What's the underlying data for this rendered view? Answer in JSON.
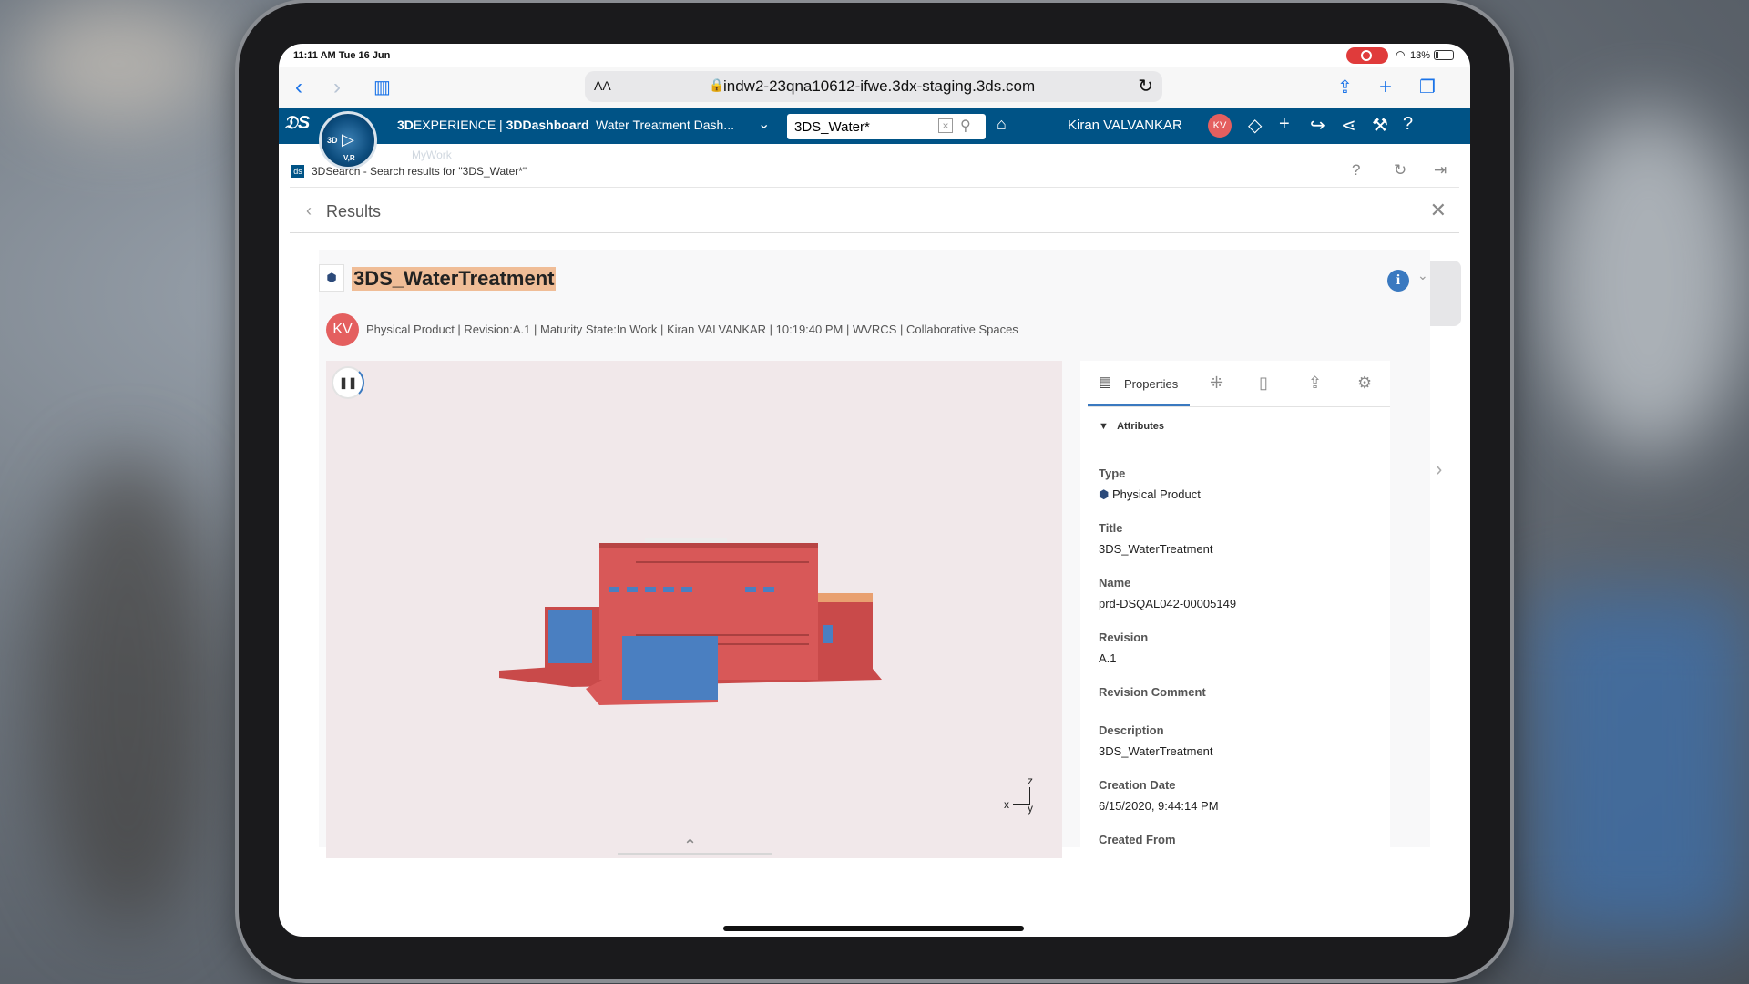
{
  "status_bar": {
    "time": "11:11 AM  Tue 16 Jun",
    "battery": "13%"
  },
  "browser": {
    "aa": "AA",
    "url": "indw2-23qna10612-ifwe.3dx-staging.3ds.com"
  },
  "topbar": {
    "brand_bold": "3D",
    "brand_main": "EXPERIENCE | ",
    "brand_app": "3DDashboard",
    "dashboard_title": "Water Treatment Dash...",
    "search_value": "3DS_Water*",
    "user_name": "Kiran VALVANKAR",
    "user_initials": "KV",
    "compass_3d": "3D",
    "compass_vr": "V,R"
  },
  "blurred": {
    "tab": "MyWork"
  },
  "panel": {
    "title": "3DSearch - Search results for \"3DS_Water*\"",
    "results_label": "Results"
  },
  "item": {
    "title": "3DS_WaterTreatment",
    "initials": "KV",
    "meta": "Physical Product | Revision:A.1 | Maturity State:In Work | Kiran VALVANKAR | 10:19:40 PM | WVRCS | Collaborative Spaces"
  },
  "viewer": {
    "axis_z": "z",
    "axis_x": "x",
    "axis_y": "y"
  },
  "properties": {
    "tab_label": "Properties",
    "section": "Attributes",
    "fields": [
      {
        "key": "Type",
        "value": "Physical Product"
      },
      {
        "key": "Title",
        "value": "3DS_WaterTreatment"
      },
      {
        "key": "Name",
        "value": "prd-DSQAL042-00005149"
      },
      {
        "key": "Revision",
        "value": "A.1"
      },
      {
        "key": "Revision Comment",
        "value": ""
      },
      {
        "key": "Description",
        "value": "3DS_WaterTreatment"
      },
      {
        "key": "Creation Date",
        "value": "6/15/2020, 9:44:14 PM"
      },
      {
        "key": "Created From",
        "value": ""
      }
    ]
  },
  "colors": {
    "brand_bar": "#005386",
    "accent": "#3a79c0",
    "highlight": "#f0bd97",
    "avatar": "#e45f5f",
    "model_red": "#d85858",
    "model_blue": "#4a7fc1"
  }
}
